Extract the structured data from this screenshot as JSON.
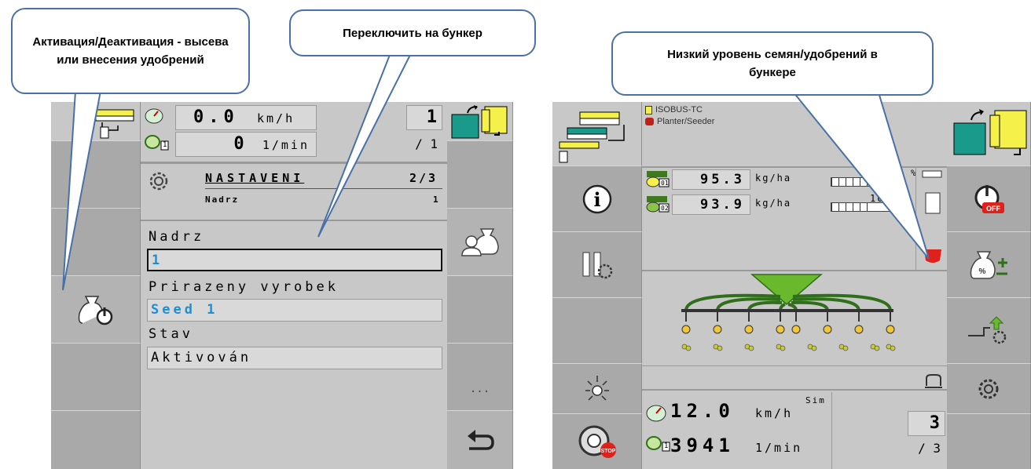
{
  "callouts": {
    "activation": "Активация/Деактивация - высева или внесения удобрений",
    "switch_tank": "Переключить на бункер",
    "low_level": "Низкий уровень семян/удобрений в бункере"
  },
  "left_screen": {
    "speed_value": "0.0",
    "speed_unit": "km/h",
    "rpm_sub": "1",
    "rpm_value": "0",
    "rpm_unit": "1/min",
    "counter_top": "1",
    "counter_bottom": "/ 1",
    "menu_title": "NASTAVENI",
    "menu_page": "2/3",
    "menu_sub": "Nadrz",
    "menu_sub_value": "1",
    "field1_label": "Nadrz",
    "field1_value": "1",
    "field2_label": "Prirazeny vyrobek",
    "field2_value": "Seed 1",
    "field3_label": "Stav",
    "field3_value": "Aktivován",
    "more_label": "..."
  },
  "right_screen": {
    "tc_title": "ISOBUS-TC",
    "tc_sub": "Planter/Seeder",
    "rate1_sub": "01",
    "rate1_value": "95.3",
    "rate1_unit": "kg/ha",
    "rate2_sub": "02",
    "rate2_value": "93.9",
    "rate2_unit": "kg/ha",
    "bar_pct": "%",
    "bar_value": "10",
    "speed_value": "12.0",
    "speed_unit": "km/h",
    "sim_label": "Sim",
    "rpm_sub": "1",
    "rpm_value": "3941",
    "rpm_unit": "1/min",
    "counter_top": "3",
    "counter_bottom": "/ 3",
    "off_label": "OFF",
    "stop_label": "STOP"
  },
  "colors": {
    "callout_border": "#4a70a8",
    "blue_text": "#1b8fd6",
    "teal": "#1a9a8a",
    "yellow": "#f5f04a",
    "green": "#3d7a1e",
    "red": "#e0201a"
  }
}
